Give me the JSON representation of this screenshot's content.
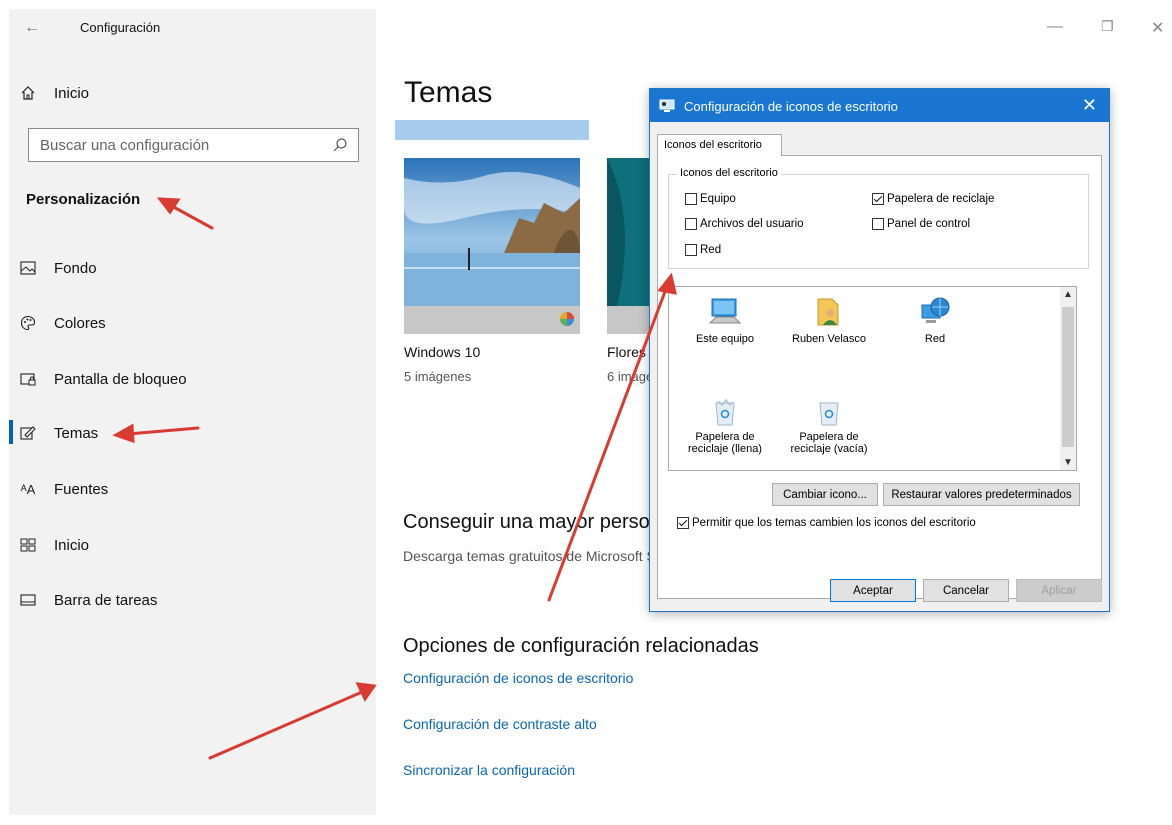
{
  "window": {
    "title": "Configuración",
    "back_icon": "back-arrow-icon",
    "controls": {
      "minimize": "—",
      "restore": "❐",
      "close": "✕"
    }
  },
  "sidebar": {
    "home_label": "Inicio",
    "search_placeholder": "Buscar una configuración",
    "section_title": "Personalización",
    "items": [
      {
        "label": "Fondo",
        "icon": "picture-icon"
      },
      {
        "label": "Colores",
        "icon": "palette-icon"
      },
      {
        "label": "Pantalla de bloqueo",
        "icon": "lock-screen-icon"
      },
      {
        "label": "Temas",
        "icon": "brush-icon",
        "active": true
      },
      {
        "label": "Fuentes",
        "icon": "font-icon"
      },
      {
        "label": "Inicio",
        "icon": "start-grid-icon"
      },
      {
        "label": "Barra de tareas",
        "icon": "taskbar-icon"
      }
    ]
  },
  "main": {
    "title": "Temas",
    "themes": [
      {
        "name": "Windows 10",
        "count": "5 imágenes"
      },
      {
        "name": "Flores",
        "count": "6 imágenes"
      }
    ],
    "more_heading": "Conseguir una mayor personalización en Microsoft Store",
    "more_desc": "Descarga temas gratuitos de Microsoft Store",
    "related_heading": "Opciones de configuración relacionadas",
    "links": [
      "Configuración de iconos de escritorio",
      "Configuración de contraste alto",
      "Sincronizar la configuración"
    ]
  },
  "dialog": {
    "title": "Configuración de iconos de escritorio",
    "tab": "Iconos del escritorio",
    "group_label": "Iconos del escritorio",
    "checkboxes": [
      {
        "label": "Equipo",
        "checked": false
      },
      {
        "label": "Papelera de reciclaje",
        "checked": true
      },
      {
        "label": "Archivos del usuario",
        "checked": false
      },
      {
        "label": "Panel de control",
        "checked": false
      },
      {
        "label": "Red",
        "checked": false
      }
    ],
    "icons": [
      {
        "label": "Este equipo",
        "icon": "computer-icon"
      },
      {
        "label": "Ruben Velasco",
        "icon": "user-folder-icon"
      },
      {
        "label": "Red",
        "icon": "network-icon"
      },
      {
        "label": "Papelera de reciclaje (llena)",
        "icon": "recycle-bin-full-icon"
      },
      {
        "label": "Papelera de reciclaje (vacía)",
        "icon": "recycle-bin-empty-icon"
      }
    ],
    "change_icon_button": "Cambiar icono...",
    "restore_button": "Restaurar valores predeterminados",
    "allow_themes_label": "Permitir que los temas cambien los iconos del escritorio",
    "allow_themes_checked": true,
    "ok_button": "Aceptar",
    "cancel_button": "Cancelar",
    "apply_button": "Aplicar"
  },
  "colors": {
    "accent": "#0063b1",
    "link": "#0b66b2",
    "dialog_title": "#1a76d0",
    "annotation_arrow": "#d93a32"
  }
}
